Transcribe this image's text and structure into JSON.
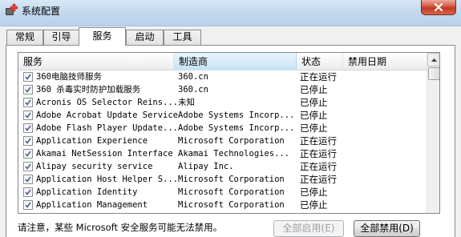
{
  "window": {
    "title": "系统配置",
    "close_glyph": "close-icon"
  },
  "tabs": [
    {
      "label": "常规"
    },
    {
      "label": "引导"
    },
    {
      "label": "服务",
      "active": true
    },
    {
      "label": "启动"
    },
    {
      "label": "工具"
    }
  ],
  "table": {
    "columns": {
      "service": "服务",
      "maker": "制造商",
      "status": "状态",
      "disabled_date": "禁用日期"
    },
    "rows": [
      {
        "checked": true,
        "service": "360电脑技师服务",
        "maker": "360.cn",
        "status": "正在运行",
        "disabled_date": ""
      },
      {
        "checked": true,
        "service": "360 杀毒实时防护加载服务",
        "maker": "360.cn",
        "status": "已停止",
        "disabled_date": ""
      },
      {
        "checked": true,
        "service": "Acronis OS Selector Reins...",
        "maker": "未知",
        "status": "已停止",
        "disabled_date": ""
      },
      {
        "checked": true,
        "service": "Adobe Acrobat Update Service",
        "maker": "Adobe Systems Incorp...",
        "status": "已停止",
        "disabled_date": ""
      },
      {
        "checked": true,
        "service": "Adobe Flash Player Update...",
        "maker": "Adobe Systems Incorp...",
        "status": "已停止",
        "disabled_date": ""
      },
      {
        "checked": true,
        "service": "Application Experience",
        "maker": "Microsoft Corporation",
        "status": "正在运行",
        "disabled_date": ""
      },
      {
        "checked": true,
        "service": "Akamai NetSession Interface",
        "maker": "Akamai Technologies...",
        "status": "正在运行",
        "disabled_date": ""
      },
      {
        "checked": true,
        "service": "Alipay security service",
        "maker": "Alipay Inc.",
        "status": "正在运行",
        "disabled_date": ""
      },
      {
        "checked": true,
        "service": "Application Host Helper S...",
        "maker": "Microsoft Corporation",
        "status": "正在运行",
        "disabled_date": ""
      },
      {
        "checked": true,
        "service": "Application Identity",
        "maker": "Microsoft Corporation",
        "status": "已停止",
        "disabled_date": ""
      },
      {
        "checked": true,
        "service": "Application Management",
        "maker": "Microsoft Corporation",
        "status": "已停止",
        "disabled_date": ""
      }
    ]
  },
  "footer": {
    "note": "请注意，某些 Microsoft 安全服务可能无法禁用。",
    "enable_all": "全部启用(E)",
    "disable_all": "全部禁用(D)"
  },
  "colors": {
    "titlebar": "#c4d9ef",
    "close": "#c2361e",
    "selected_header": "#d6ebf9"
  }
}
